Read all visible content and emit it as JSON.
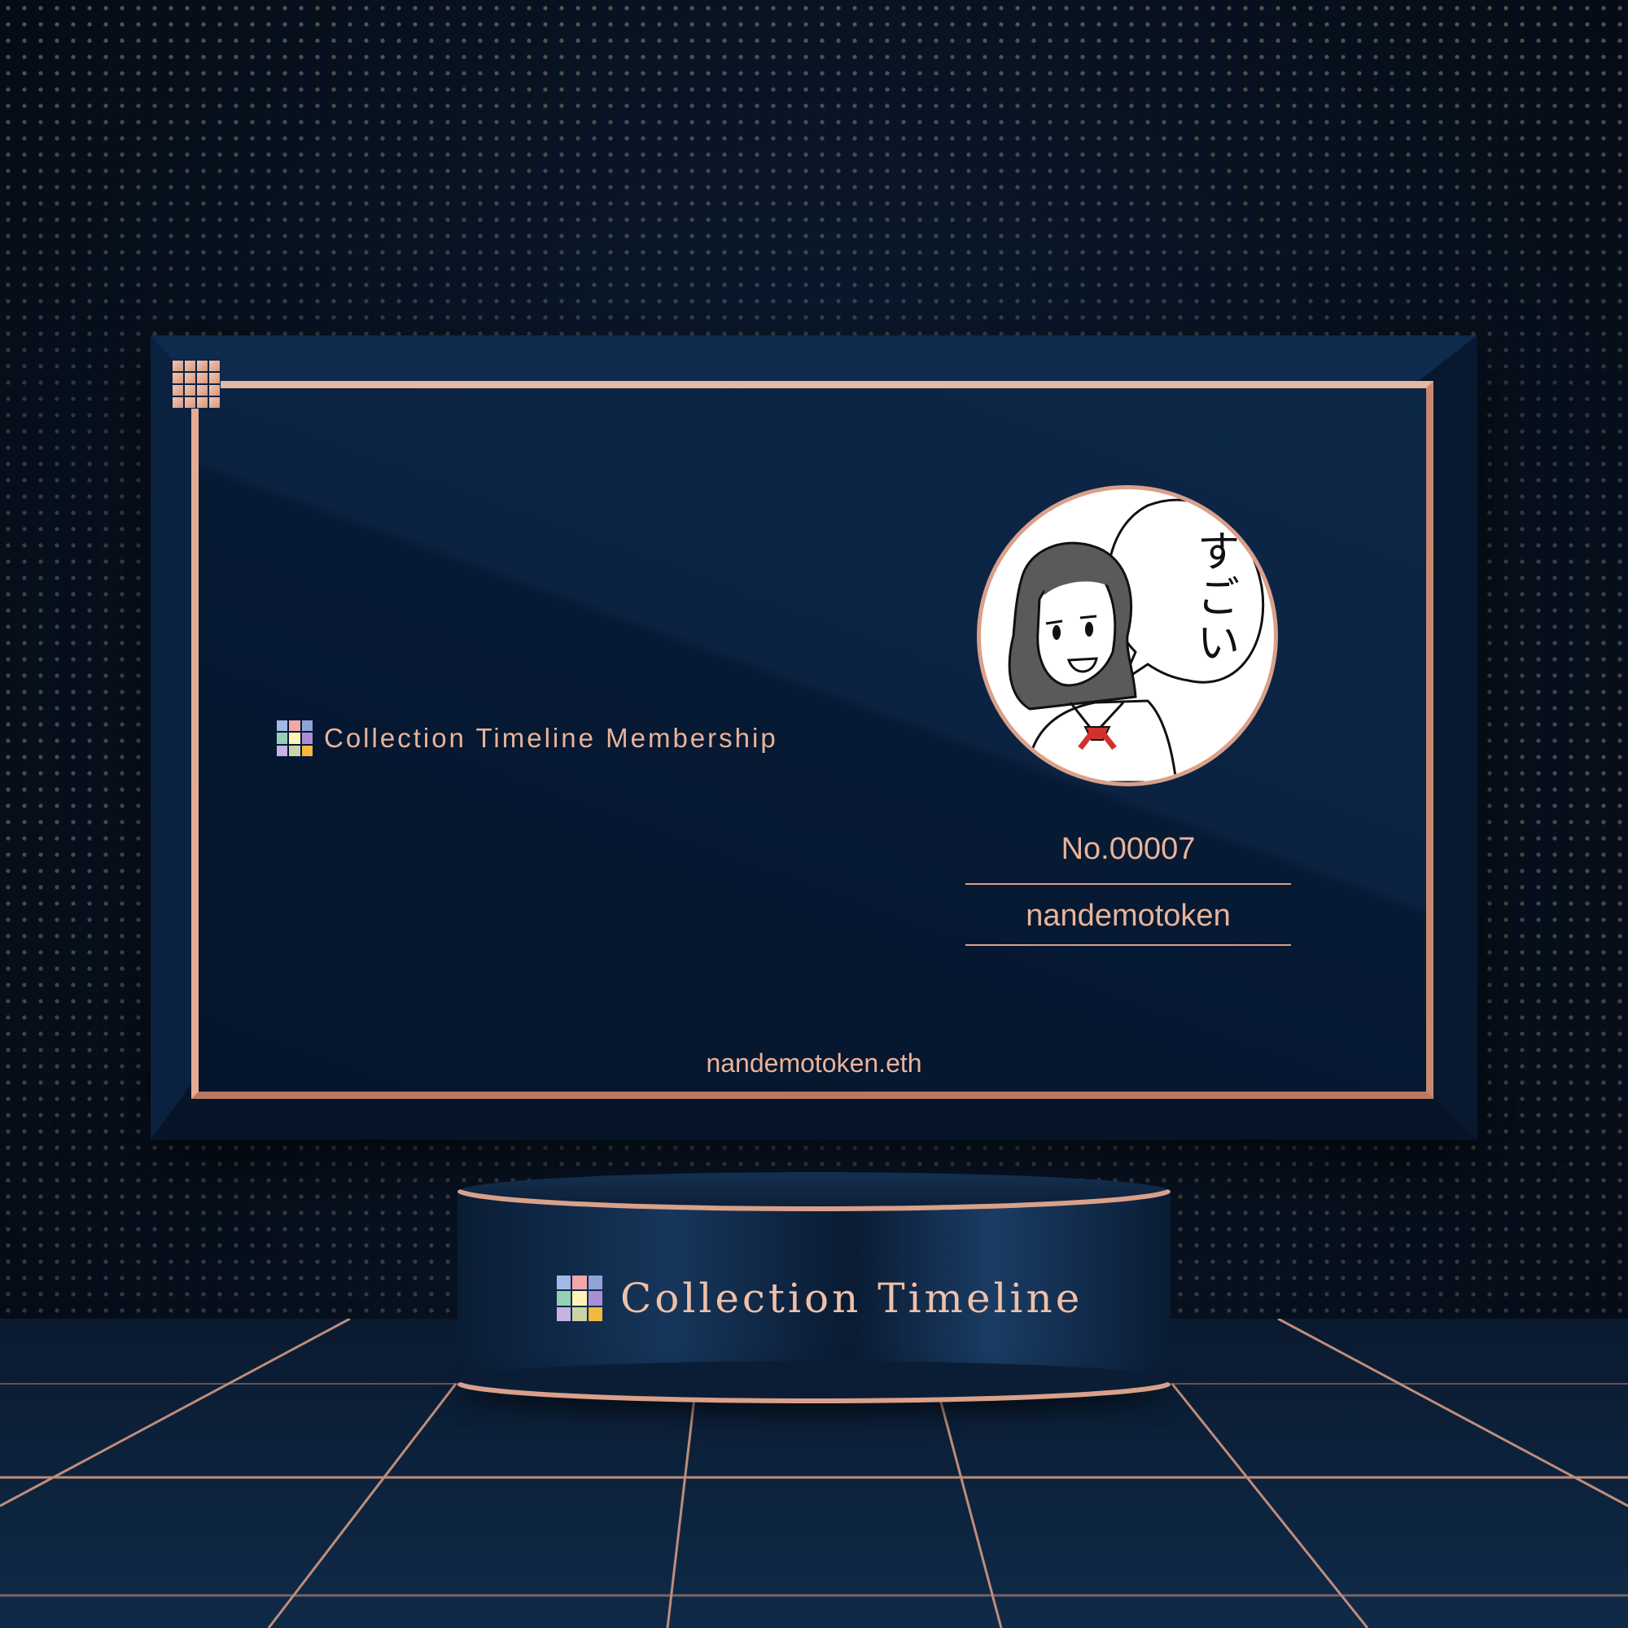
{
  "card": {
    "title": "Collection Timeline Membership",
    "member_number": "No.00007",
    "member_name": "nandemotoken",
    "ens": "nandemotoken.eth",
    "speech_text": "すごい"
  },
  "podium": {
    "brand": "Collection Timeline"
  },
  "colors": {
    "accent": "#d9a08a",
    "background": "#07111f",
    "card": "#0b2242",
    "text": "#e9b39a"
  },
  "logo_colors": [
    "#a1b9e6",
    "#f2a7a8",
    "#8fa3d8",
    "#94cfb7",
    "#fff3b3",
    "#a98ed6",
    "#c8b2e3",
    "#c9d4a7",
    "#f4b73f"
  ]
}
